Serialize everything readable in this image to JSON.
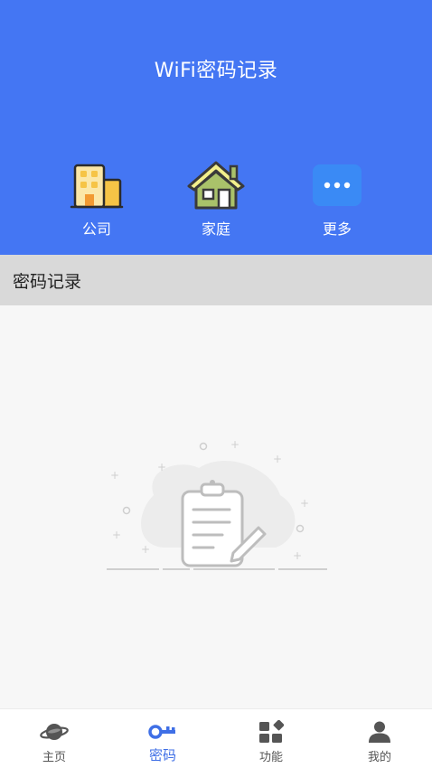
{
  "header": {
    "title": "WiFi密码记录"
  },
  "categories": [
    {
      "label": "公司",
      "icon": "office-building-icon"
    },
    {
      "label": "家庭",
      "icon": "house-icon"
    },
    {
      "label": "更多",
      "icon": "more-dots-icon"
    }
  ],
  "section": {
    "title": "密码记录"
  },
  "empty_state": {
    "icon": "clipboard-empty-icon"
  },
  "tabbar": {
    "active": "密码",
    "items": [
      {
        "label": "主页",
        "icon": "planet-icon"
      },
      {
        "label": "密码",
        "icon": "key-icon"
      },
      {
        "label": "功能",
        "icon": "grid-icon"
      },
      {
        "label": "我的",
        "icon": "person-icon"
      }
    ]
  },
  "colors": {
    "header_bg": "#4476f3",
    "section_bg": "#d9d9d9",
    "active_tab": "#3f6fe6",
    "more_icon_bg": "#3a8af5"
  }
}
